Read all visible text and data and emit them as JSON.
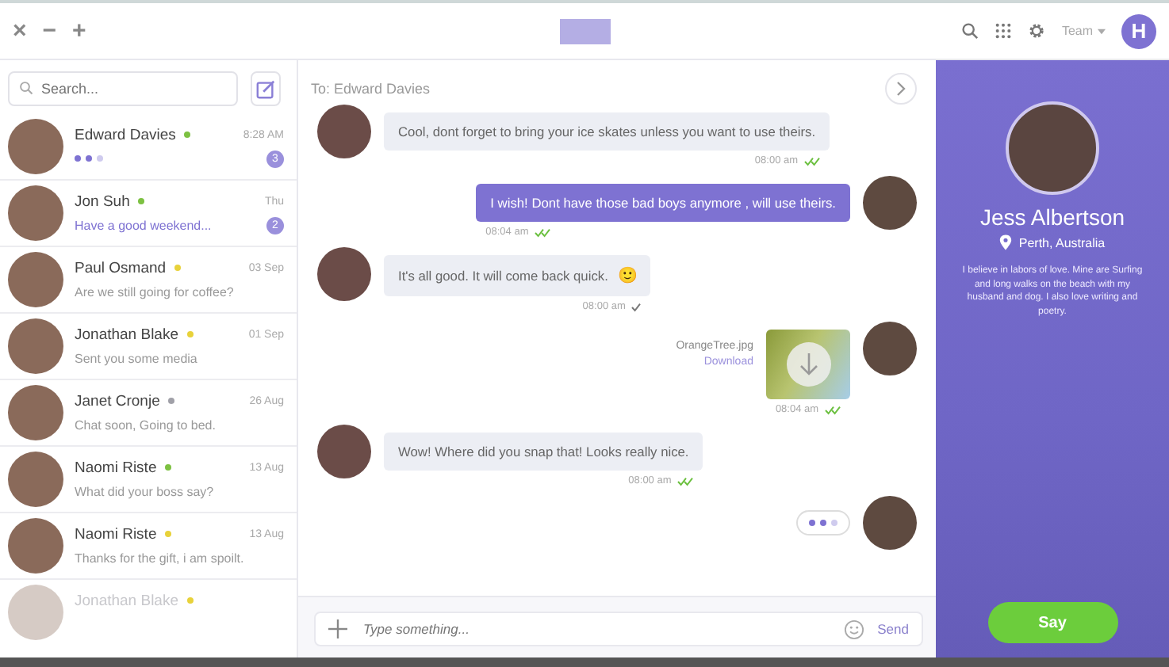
{
  "window": {
    "controls": [
      "×",
      "−",
      "+"
    ],
    "team": "Team",
    "avatar_letter": "H"
  },
  "sidebar": {
    "search": {
      "placeholder": "Search..."
    },
    "contacts": [
      {
        "name": "Edward Davies",
        "color": "#7dc142",
        "time": "8:28 AM",
        "kind": "typing",
        "badge": "3",
        "faded": false
      },
      {
        "name": "Jon Suh",
        "color": "#7dc142",
        "time": "Thu",
        "kind": "text",
        "preview": "Have a good weekend...",
        "badge": "2",
        "unread": true,
        "faded": false
      },
      {
        "name": "Paul Osmand",
        "color": "#e8d23a",
        "time": "03 Sep",
        "kind": "text",
        "preview": "Are we still going for coffee?",
        "unread": false,
        "faded": false
      },
      {
        "name": "Jonathan Blake",
        "color": "#e8d23a",
        "time": "01 Sep",
        "kind": "text",
        "preview": "Sent you some media",
        "unread": false,
        "faded": false
      },
      {
        "name": "Janet Cronje",
        "color": "#a0a0a8",
        "time": "26 Aug",
        "kind": "text",
        "preview": "Chat soon, Going to bed.",
        "unread": false,
        "faded": false
      },
      {
        "name": "Naomi Riste",
        "color": "#7dc142",
        "time": "13 Aug",
        "kind": "text",
        "preview": "What did your boss say?",
        "unread": false,
        "faded": false
      },
      {
        "name": "Naomi Riste",
        "color": "#e8d23a",
        "time": "13 Aug",
        "kind": "text",
        "preview": "Thanks for the gift, i am spoilt.",
        "unread": false,
        "faded": false
      },
      {
        "name": "Jonathan Blake",
        "color": "#e8d23a",
        "kind": "none",
        "faded": true
      }
    ]
  },
  "chat": {
    "to": "To: Edward Davies",
    "messages": [
      {
        "kind": "incoming",
        "text": "Cool, dont forget to bring your ice skates unless you want to use theirs.",
        "time": "08:00 am",
        "read": true
      },
      {
        "kind": "outgoing",
        "text": "I wish! Dont have those bad boys anymore , will use theirs.",
        "time": "08:04 am",
        "read": true
      },
      {
        "kind": "incoming",
        "text": "It's all good. It will come back quick.",
        "emoji": "🙂",
        "time": "08:00 am",
        "read": false
      },
      {
        "kind": "file",
        "filename": "OrangeTree.jpg",
        "link": "Download",
        "time": "08:04 am",
        "read": true
      },
      {
        "kind": "incoming",
        "text": "Wow! Where did you snap that! Looks really nice.",
        "time": "08:00 am",
        "read": true
      },
      {
        "kind": "typing"
      }
    ],
    "input": {
      "placeholder": "Type something...",
      "send": "Send"
    }
  },
  "profile": {
    "name": "Jess Albertson",
    "location": "Perth, Australia",
    "bio": "I believe in labors of love. Mine are Surfing and long walks on the beach with my husband and dog. I also love writing and poetry.",
    "button": "Say"
  }
}
